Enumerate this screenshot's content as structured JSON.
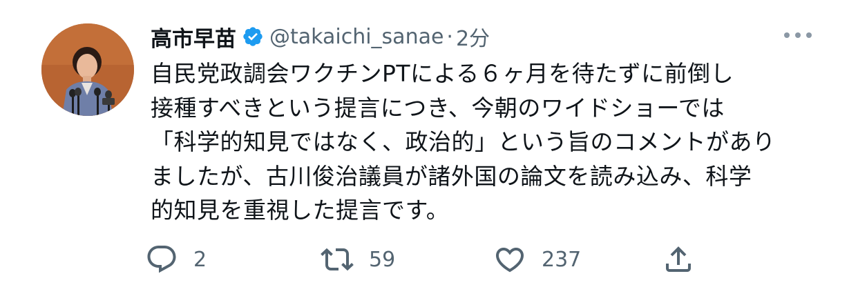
{
  "tweet": {
    "author_name": "高市早苗",
    "handle": "@takaichi_sanae",
    "separator": "·",
    "time": "2分",
    "text_lines": [
      "自民党政調会ワクチンPTによる６ヶ月を待たずに前倒し",
      "接種すべきという提言につき、今朝のワイドショーでは",
      "「科学的知見ではなく、政治的」という旨のコメントがあり",
      "ましたが、古川俊治議員が諸外国の論文を読み込み、科学",
      "的知見を重視した提言です。"
    ],
    "verified": true
  },
  "actions": {
    "reply_count": "2",
    "retweet_count": "59",
    "like_count": "237"
  },
  "icons": {
    "verified": "verified-badge-icon",
    "more": "more-horizontal-icon",
    "reply": "reply-icon",
    "retweet": "retweet-icon",
    "like": "heart-icon",
    "share": "share-icon"
  },
  "colors": {
    "text": "#0f1419",
    "secondary": "#536471",
    "verified": "#1d9bf0",
    "avatar_bg": "#b5622e"
  }
}
